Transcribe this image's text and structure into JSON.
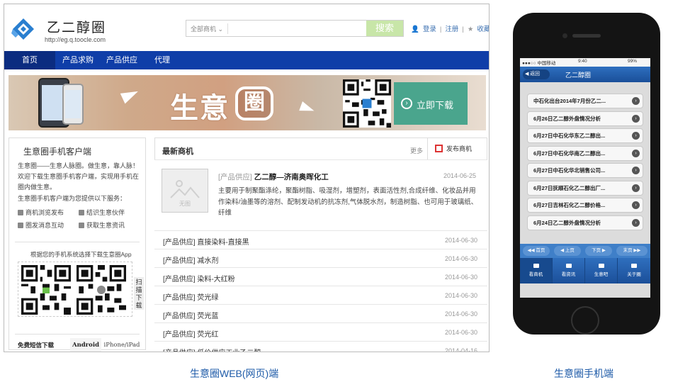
{
  "web": {
    "site_name": "乙二醇圈",
    "site_url": "http://eg.q.toocle.com",
    "search": {
      "category": "全部商机",
      "placeholder": "",
      "button": "搜索"
    },
    "top_links": {
      "login": "登录",
      "divider": "|",
      "register": "注册",
      "favorite": "收藏"
    },
    "nav": [
      "首页",
      "产品求购",
      "产品供应",
      "代理"
    ],
    "banner": {
      "title": "生意",
      "title_circle": "圈",
      "download": "立即下载"
    },
    "left": {
      "title": "生意圈手机客户端",
      "desc": "生意圈——生意人脉圈。做生意，靠人脉！欢迎下载生意圈手机客户端，实现用手机在圈内做生意。",
      "service_intro": "生意圈手机客户端为您提供以下服务：",
      "features": [
        "商机浏览发布",
        "结识生意伙伴",
        "圈发消息互动",
        "获取生意资讯"
      ],
      "choose": "根据您的手机系统选择下载生意圈App",
      "scan": "扫描下载",
      "sms_tabs": [
        "免费短信下载",
        "Android",
        "iPhone/iPad"
      ]
    },
    "latest": {
      "title": "最新商机",
      "more": "更多",
      "publish": "发布商机",
      "feature": {
        "thumb_label": "无图",
        "category": "[产品供应]",
        "name": "乙二醇—济南奥晖化工",
        "date": "2014-06-25",
        "desc": "主要用于制聚酯涤纶，聚酯树脂、吸湿剂，增塑剂，表面活性剂,合成纤维、化妆品并用作染料/油墨等的溶剂、配制发动机的抗冻剂,气体脱水剂，制造树脂、也可用于玻璃纸、纤维"
      },
      "rows": [
        {
          "name": "[产品供应] 直接染料-直接黑",
          "date": "2014-06-30"
        },
        {
          "name": "[产品供应] 减水剂",
          "date": "2014-06-30"
        },
        {
          "name": "[产品供应] 染料-大红粉",
          "date": "2014-06-30"
        },
        {
          "name": "[产品供应] 荧光绿",
          "date": "2014-06-30"
        },
        {
          "name": "[产品供应] 荧光蓝",
          "date": "2014-06-30"
        },
        {
          "name": "[产品供应] 荧光红",
          "date": "2014-06-30"
        },
        {
          "name": "[产品供应] 低价供应工业乙二醇",
          "date": "2014-04-16"
        }
      ]
    }
  },
  "mobile": {
    "status": {
      "carrier": "●●●○○ 中国移动 ",
      "time": "9:40",
      "battery": "99%"
    },
    "back": "返回",
    "title": "乙二醇圈",
    "items": [
      "中石化出台2014年7月份乙二...",
      "6月26日乙二醇外盘情况分析",
      "6月27日中石化华东乙二醇出...",
      "6月27日中石化华南乙二醇出...",
      "6月27日中石化华北销售公司...",
      "6月27日抚顺石化乙二醇出厂...",
      "6月27日吉林石化乙二醇价格...",
      "6月24日乙二醇外盘情况分析"
    ],
    "pager": [
      "首页",
      "上页",
      "下页",
      "末页"
    ],
    "tabs": [
      "看商机",
      "看资讯",
      "生意吧",
      "关于圈"
    ]
  },
  "captions": {
    "web": "生意圈WEB(网页)端",
    "mobile": "生意圈手机端"
  }
}
